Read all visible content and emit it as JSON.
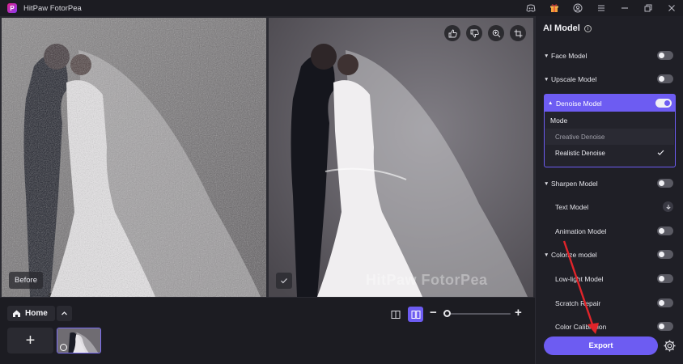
{
  "app": {
    "title": "HitPaw FotorPea",
    "logo_letter": "P"
  },
  "titlebar_icons": [
    "discord-icon",
    "gift-icon",
    "user-icon",
    "menu-icon",
    "minimize-icon",
    "restore-icon",
    "close-icon"
  ],
  "canvas": {
    "before_label": "Before",
    "watermark": "HitPaw FotorPea",
    "tools": [
      "thumbs-up-icon",
      "thumbs-down-icon",
      "zoom-icon",
      "crop-icon"
    ]
  },
  "bottom": {
    "home_label": "Home",
    "add_label": "+",
    "zoom_minus": "−",
    "zoom_plus": "+",
    "zoom_level": 0.0
  },
  "panel": {
    "title": "AI Model",
    "models": [
      {
        "label": "Face Model",
        "on": false
      },
      {
        "label": "Upscale Model",
        "on": false
      },
      {
        "label": "Denoise Model",
        "on": true
      }
    ],
    "denoise": {
      "mode_label": "Mode",
      "options": [
        "Creative Denoise",
        "Realistic Denoise"
      ],
      "selected": "Realistic Denoise"
    },
    "sharpen_label": "Sharpen Model",
    "text_model_label": "Text Model",
    "animation_label": "Animation Model",
    "colorize_label": "Colorize model",
    "lowlight_label": "Low-light Model",
    "scratch_label": "Scratch Repair",
    "color_calib_label": "Color Calibration",
    "export_label": "Export"
  },
  "colors": {
    "accent": "#6d5cf2",
    "panel_bg": "#1f1f26",
    "arrow": "#e0242a"
  }
}
